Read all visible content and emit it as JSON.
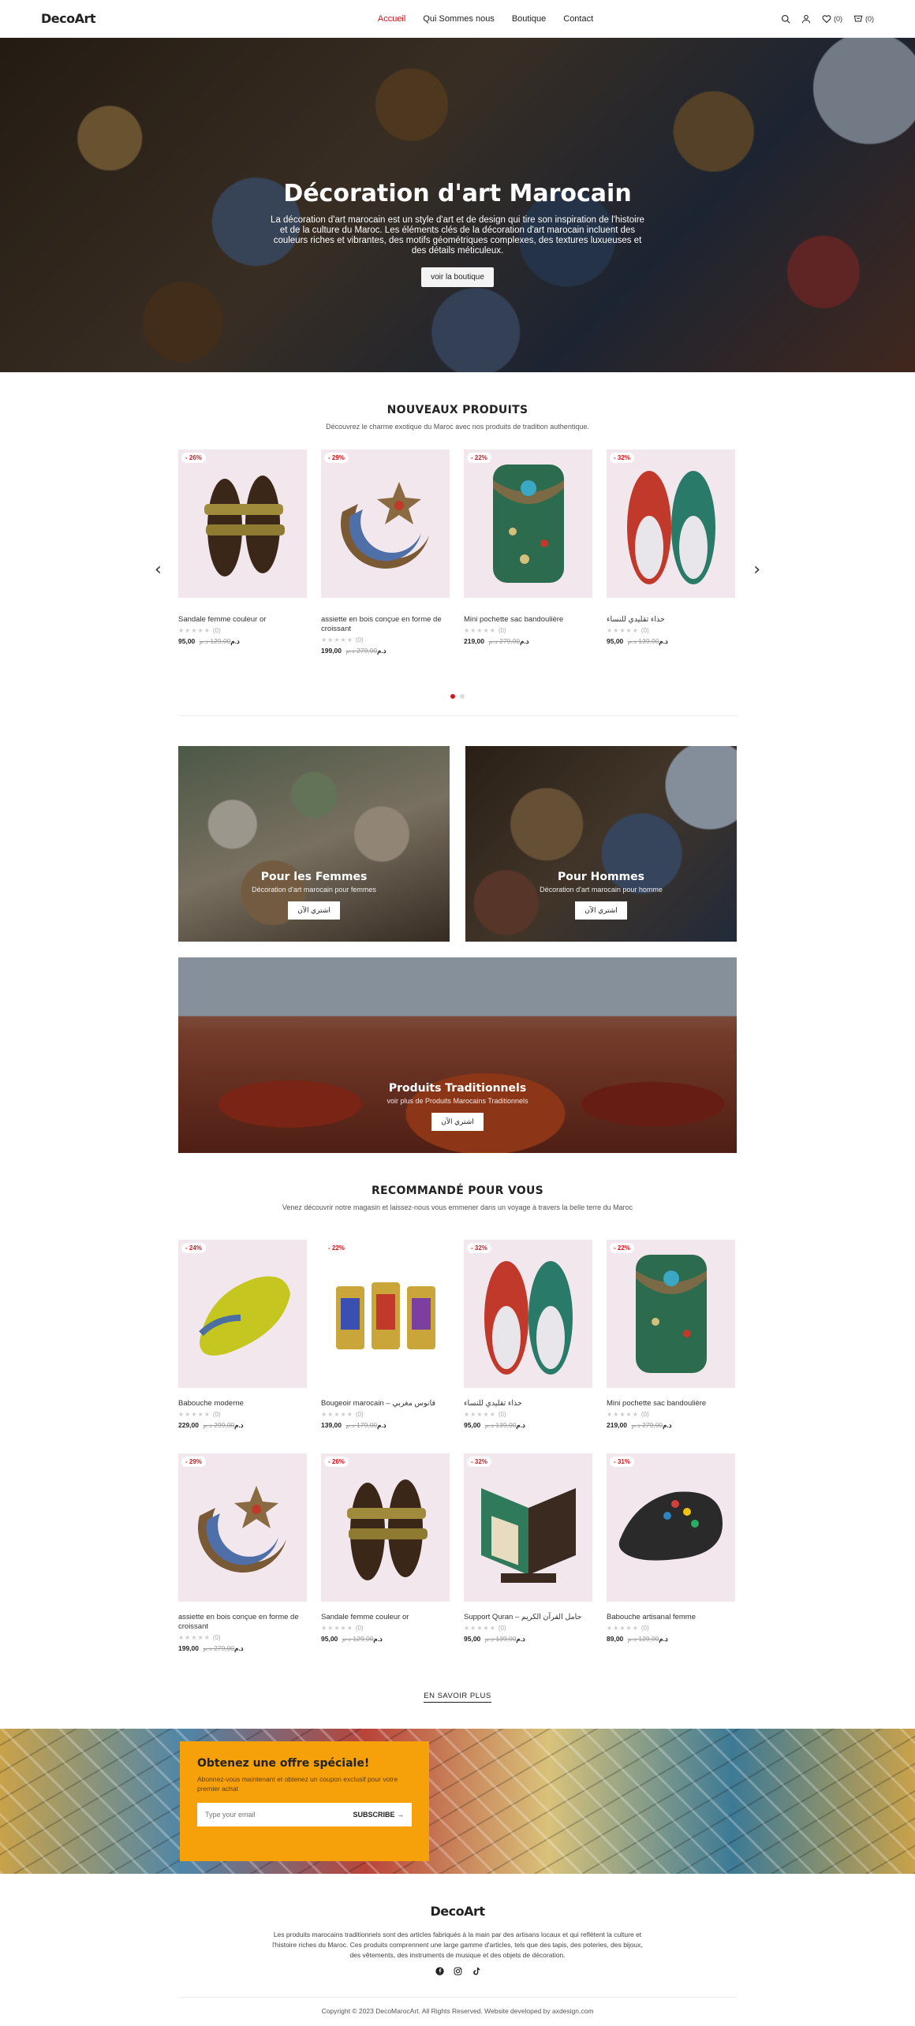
{
  "header": {
    "logo": "DecoArt",
    "nav": [
      "Accueil",
      "Qui Sommes nous",
      "Boutique",
      "Contact"
    ],
    "wishlist_count": "(0)",
    "cart_count": "(0)",
    "icons": [
      "search-icon",
      "user-icon",
      "heart-icon",
      "cart-icon"
    ]
  },
  "hero": {
    "title": "Décoration d'art Marocain",
    "text": "La décoration d'art marocain est un style d'art et de design qui tire son inspiration de l'histoire et de la culture du Maroc. Les éléments clés de la décoration d'art marocain incluent des couleurs riches et vibrantes, des motifs géométriques complexes, des textures luxueuses et des détails méticuleux.",
    "button": "voir la boutique"
  },
  "new_products": {
    "title": "NOUVEAUX PRODUITS",
    "subtitle": "Découvrez le charme exotique du Maroc avec nos produits de tradition authentique.",
    "items": [
      {
        "badge": "- 26%",
        "name": "Sandale femme couleur or",
        "reviews": "(0)",
        "price": "95,00 د.م",
        "old_price": "129,00 د.م"
      },
      {
        "badge": "- 29%",
        "name": "assiette en bois conçue en forme de croissant",
        "reviews": "(0)",
        "price": "199,00 د.م",
        "old_price": "279,00 د.م"
      },
      {
        "badge": "- 22%",
        "name": "Mini pochette sac bandoulière",
        "reviews": "(0)",
        "price": "219,00 د.م",
        "old_price": "279,00 د.م"
      },
      {
        "badge": "- 32%",
        "name": "حذاء تقليدي للنساء",
        "reviews": "(0)",
        "price": "95,00 د.م",
        "old_price": "139,00 د.م"
      }
    ]
  },
  "categories": {
    "women": {
      "title": "Pour les Femmes",
      "subtitle": "Décoration d'art marocain pour femmes",
      "button": "اشتري الآن"
    },
    "men": {
      "title": "Pour Hommes",
      "subtitle": "Décoration d'art marocain pour homme",
      "button": "اشتري الآن"
    },
    "traditional": {
      "title": "Produits Traditionnels",
      "subtitle": "voir plus de Produits Marocains Traditionnels",
      "button": "اشتري الآن"
    }
  },
  "recommended": {
    "title": "RECOMMANDÉ POUR VOUS",
    "subtitle": "Venez découvrir notre magasin et laissez-nous vous emmener dans un voyage à travers la belle terre du Maroc",
    "items": [
      {
        "badge": "- 24%",
        "name": "Babouche moderne",
        "reviews": "(0)",
        "price": "229,00 د.م",
        "old_price": "299,00 د.م"
      },
      {
        "badge": "- 22%",
        "name": "Bougeoir marocain – فانوس مغربي",
        "reviews": "(0)",
        "price": "139,00 د.م",
        "old_price": "179,00 د.م"
      },
      {
        "badge": "- 32%",
        "name": "حذاء تقليدي للنساء",
        "reviews": "(0)",
        "price": "95,00 د.م",
        "old_price": "139,00 د.م"
      },
      {
        "badge": "- 22%",
        "name": "Mini pochette sac bandoulière",
        "reviews": "(0)",
        "price": "219,00 د.م",
        "old_price": "279,00 د.م"
      },
      {
        "badge": "- 29%",
        "name": "assiette en bois conçue en forme de croissant",
        "reviews": "(0)",
        "price": "199,00 د.م",
        "old_price": "279,00 د.م"
      },
      {
        "badge": "- 26%",
        "name": "Sandale femme couleur or",
        "reviews": "(0)",
        "price": "95,00 د.م",
        "old_price": "129,00 د.م"
      },
      {
        "badge": "- 32%",
        "name": "Support Quran – حامل القرآن الكريم",
        "reviews": "(0)",
        "price": "95,00 د.م",
        "old_price": "139,00 د.م"
      },
      {
        "badge": "- 31%",
        "name": "Babouche artisanal femme",
        "reviews": "(0)",
        "price": "89,00 د.م",
        "old_price": "129,00 د.م"
      }
    ],
    "more": "EN SAVOIR PLUS"
  },
  "newsletter": {
    "title": "Obtenez une offre spéciale!",
    "text": "Abonnez-vous maintenant et obtenez un coupon exclusif pour votre premier achat",
    "placeholder": "Type your email",
    "button": "SUBSCRIBE"
  },
  "footer": {
    "logo": "DecoArt",
    "text": "Les produits marocains traditionnels sont des articles fabriqués à la main par des artisans locaux et qui reflètent la culture et l'histoire riches du Maroc. Ces produits comprennent une large gamme d'articles, tels que des tapis, des poteries, des bijoux, des vêtements, des instruments de musique et des objets de décoration.",
    "socials": [
      "facebook-icon",
      "instagram-icon",
      "tiktok-icon"
    ],
    "copyright": "Copyright © 2023 DecoMarocArt. All Rights Reserved. Website developed by axdesign.com"
  },
  "colors": {
    "accent": "#d0161e",
    "offer": "#f7a10a",
    "thumb_bg": "#f1e7ec"
  }
}
